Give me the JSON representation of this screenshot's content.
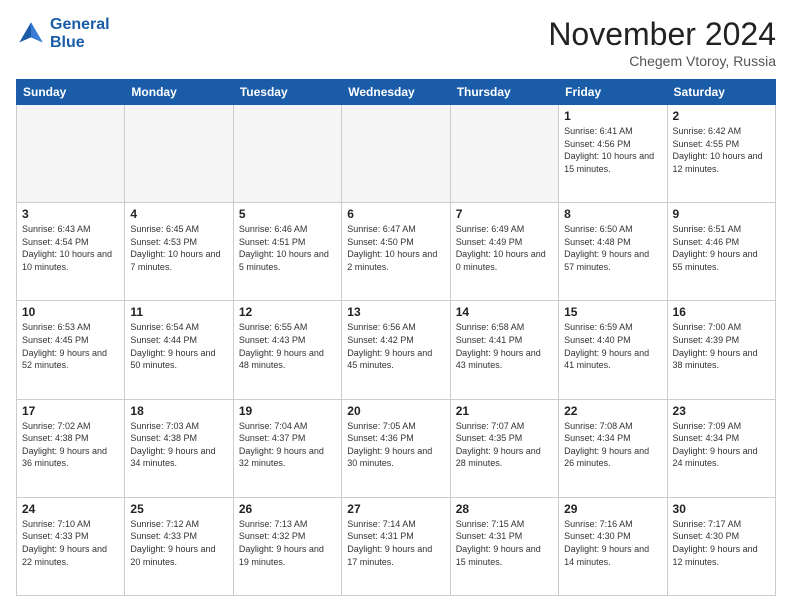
{
  "header": {
    "logo_line1": "General",
    "logo_line2": "Blue",
    "month_title": "November 2024",
    "location": "Chegem Vtoroy, Russia"
  },
  "weekdays": [
    "Sunday",
    "Monday",
    "Tuesday",
    "Wednesday",
    "Thursday",
    "Friday",
    "Saturday"
  ],
  "weeks": [
    [
      {
        "day": "",
        "info": ""
      },
      {
        "day": "",
        "info": ""
      },
      {
        "day": "",
        "info": ""
      },
      {
        "day": "",
        "info": ""
      },
      {
        "day": "",
        "info": ""
      },
      {
        "day": "1",
        "info": "Sunrise: 6:41 AM\nSunset: 4:56 PM\nDaylight: 10 hours and 15 minutes."
      },
      {
        "day": "2",
        "info": "Sunrise: 6:42 AM\nSunset: 4:55 PM\nDaylight: 10 hours and 12 minutes."
      }
    ],
    [
      {
        "day": "3",
        "info": "Sunrise: 6:43 AM\nSunset: 4:54 PM\nDaylight: 10 hours and 10 minutes."
      },
      {
        "day": "4",
        "info": "Sunrise: 6:45 AM\nSunset: 4:53 PM\nDaylight: 10 hours and 7 minutes."
      },
      {
        "day": "5",
        "info": "Sunrise: 6:46 AM\nSunset: 4:51 PM\nDaylight: 10 hours and 5 minutes."
      },
      {
        "day": "6",
        "info": "Sunrise: 6:47 AM\nSunset: 4:50 PM\nDaylight: 10 hours and 2 minutes."
      },
      {
        "day": "7",
        "info": "Sunrise: 6:49 AM\nSunset: 4:49 PM\nDaylight: 10 hours and 0 minutes."
      },
      {
        "day": "8",
        "info": "Sunrise: 6:50 AM\nSunset: 4:48 PM\nDaylight: 9 hours and 57 minutes."
      },
      {
        "day": "9",
        "info": "Sunrise: 6:51 AM\nSunset: 4:46 PM\nDaylight: 9 hours and 55 minutes."
      }
    ],
    [
      {
        "day": "10",
        "info": "Sunrise: 6:53 AM\nSunset: 4:45 PM\nDaylight: 9 hours and 52 minutes."
      },
      {
        "day": "11",
        "info": "Sunrise: 6:54 AM\nSunset: 4:44 PM\nDaylight: 9 hours and 50 minutes."
      },
      {
        "day": "12",
        "info": "Sunrise: 6:55 AM\nSunset: 4:43 PM\nDaylight: 9 hours and 48 minutes."
      },
      {
        "day": "13",
        "info": "Sunrise: 6:56 AM\nSunset: 4:42 PM\nDaylight: 9 hours and 45 minutes."
      },
      {
        "day": "14",
        "info": "Sunrise: 6:58 AM\nSunset: 4:41 PM\nDaylight: 9 hours and 43 minutes."
      },
      {
        "day": "15",
        "info": "Sunrise: 6:59 AM\nSunset: 4:40 PM\nDaylight: 9 hours and 41 minutes."
      },
      {
        "day": "16",
        "info": "Sunrise: 7:00 AM\nSunset: 4:39 PM\nDaylight: 9 hours and 38 minutes."
      }
    ],
    [
      {
        "day": "17",
        "info": "Sunrise: 7:02 AM\nSunset: 4:38 PM\nDaylight: 9 hours and 36 minutes."
      },
      {
        "day": "18",
        "info": "Sunrise: 7:03 AM\nSunset: 4:38 PM\nDaylight: 9 hours and 34 minutes."
      },
      {
        "day": "19",
        "info": "Sunrise: 7:04 AM\nSunset: 4:37 PM\nDaylight: 9 hours and 32 minutes."
      },
      {
        "day": "20",
        "info": "Sunrise: 7:05 AM\nSunset: 4:36 PM\nDaylight: 9 hours and 30 minutes."
      },
      {
        "day": "21",
        "info": "Sunrise: 7:07 AM\nSunset: 4:35 PM\nDaylight: 9 hours and 28 minutes."
      },
      {
        "day": "22",
        "info": "Sunrise: 7:08 AM\nSunset: 4:34 PM\nDaylight: 9 hours and 26 minutes."
      },
      {
        "day": "23",
        "info": "Sunrise: 7:09 AM\nSunset: 4:34 PM\nDaylight: 9 hours and 24 minutes."
      }
    ],
    [
      {
        "day": "24",
        "info": "Sunrise: 7:10 AM\nSunset: 4:33 PM\nDaylight: 9 hours and 22 minutes."
      },
      {
        "day": "25",
        "info": "Sunrise: 7:12 AM\nSunset: 4:33 PM\nDaylight: 9 hours and 20 minutes."
      },
      {
        "day": "26",
        "info": "Sunrise: 7:13 AM\nSunset: 4:32 PM\nDaylight: 9 hours and 19 minutes."
      },
      {
        "day": "27",
        "info": "Sunrise: 7:14 AM\nSunset: 4:31 PM\nDaylight: 9 hours and 17 minutes."
      },
      {
        "day": "28",
        "info": "Sunrise: 7:15 AM\nSunset: 4:31 PM\nDaylight: 9 hours and 15 minutes."
      },
      {
        "day": "29",
        "info": "Sunrise: 7:16 AM\nSunset: 4:30 PM\nDaylight: 9 hours and 14 minutes."
      },
      {
        "day": "30",
        "info": "Sunrise: 7:17 AM\nSunset: 4:30 PM\nDaylight: 9 hours and 12 minutes."
      }
    ]
  ]
}
